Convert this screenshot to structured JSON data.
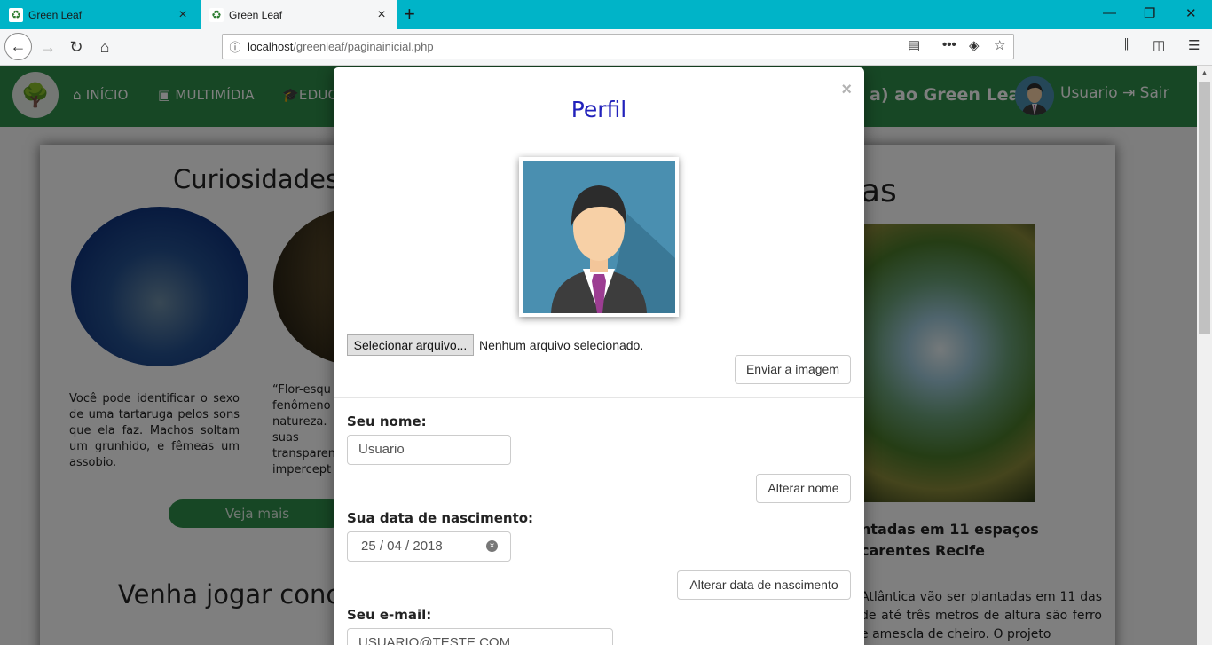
{
  "browser": {
    "tabs": [
      {
        "title": "Green Leaf",
        "active": false
      },
      {
        "title": "Green Leaf",
        "active": true
      }
    ],
    "url_host": "localhost",
    "url_path": "/greenleaf/paginainicial.php",
    "new_tab_symbol": "+",
    "window_controls": {
      "minimize": "—",
      "restore": "❐",
      "close": "✕"
    }
  },
  "site": {
    "menu": {
      "inicio": "INÍCIO",
      "multimidia": "MULTIMÍDIA",
      "educ": "EDUC"
    },
    "welcome_partial": "a) ao Green Leaf ,",
    "user_name": "Usuario",
    "logout": "Sair"
  },
  "content": {
    "curiosidades_title": "Curiosidades",
    "para1": "Você pode identificar o sexo de uma tartaruga pelos sons que ela faz. Machos soltam um grunhido, e fêmeas um assobio.",
    "para2_lines": [
      "“Flor-esqu",
      "fenômeno",
      "natureza.",
      "suas",
      "transparen",
      "impercept"
    ],
    "veja_mais": "Veja mais",
    "venha_title": "Venha jogar conc",
    "as_title": "as",
    "news_title": "ntadas em 11 espaços carentes Recife",
    "news_text": "Atlântica vão ser plantadas em 11 das de até três metros de altura são ferro e amescla de cheiro. O projeto"
  },
  "modal": {
    "title": "Perfil",
    "close_symbol": "×",
    "file_button": "Selecionar arquivo...",
    "file_status": "Nenhum arquivo selecionado.",
    "upload_button": "Enviar a imagem",
    "name_label": "Seu nome:",
    "name_value": "Usuario",
    "name_button": "Alterar nome",
    "birth_label": "Sua data de nascimento:",
    "birth_value": "25 / 04 / 2018",
    "birth_button": "Alterar data de nascimento",
    "email_label": "Seu e-mail:",
    "email_value": "USUARIO@TESTE.COM"
  },
  "colors": {
    "tabbar": "#00b4c8",
    "header_green": "#2f8f4a",
    "modal_title": "#2222bb"
  }
}
